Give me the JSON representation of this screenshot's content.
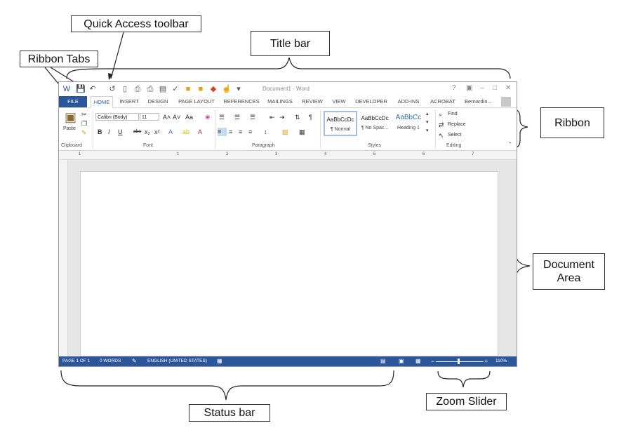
{
  "callouts": {
    "quick_access": "Quick Access toolbar",
    "title_bar": "Title bar",
    "ribbon_tabs": "Ribbon Tabs",
    "ribbon": "Ribbon",
    "document_area": "Document\nArea",
    "status_bar": "Status bar",
    "zoom_slider": "Zoom Slider"
  },
  "window": {
    "doc_title": "Document1 - Word",
    "controls": [
      "?",
      "▣",
      "–",
      "□",
      "✕"
    ]
  },
  "tabs": [
    "FILE",
    "HOME",
    "INSERT",
    "DESIGN",
    "PAGE LAYOUT",
    "REFERENCES",
    "MAILINGS",
    "REVIEW",
    "VIEW",
    "DEVELOPER",
    "ADD-INS",
    "ACROBAT"
  ],
  "user_name": "Bernardin...",
  "ribbon": {
    "paste_label": "Paste",
    "font_name": "Calibri (Body)",
    "font_size": "11",
    "groups": [
      "Clipboard",
      "Font",
      "Paragraph",
      "Styles",
      "Editing"
    ],
    "styles": [
      {
        "sample": "AaBbCcDc",
        "name": "¶ Normal"
      },
      {
        "sample": "AaBbCcDc",
        "name": "¶ No Spac..."
      },
      {
        "sample": "AaBbCc",
        "name": "Heading 1"
      }
    ],
    "editing": {
      "find": "Find",
      "replace": "Replace",
      "select": "Select"
    }
  },
  "ruler_numbers": [
    "1",
    "1",
    "2",
    "3",
    "4",
    "5",
    "6",
    "7"
  ],
  "status": {
    "page": "PAGE 1 OF 1",
    "words": "0 WORDS",
    "language": "ENGLISH (UNITED STATES)",
    "zoom": "110%"
  },
  "colors": {
    "accent": "#2b579a"
  }
}
